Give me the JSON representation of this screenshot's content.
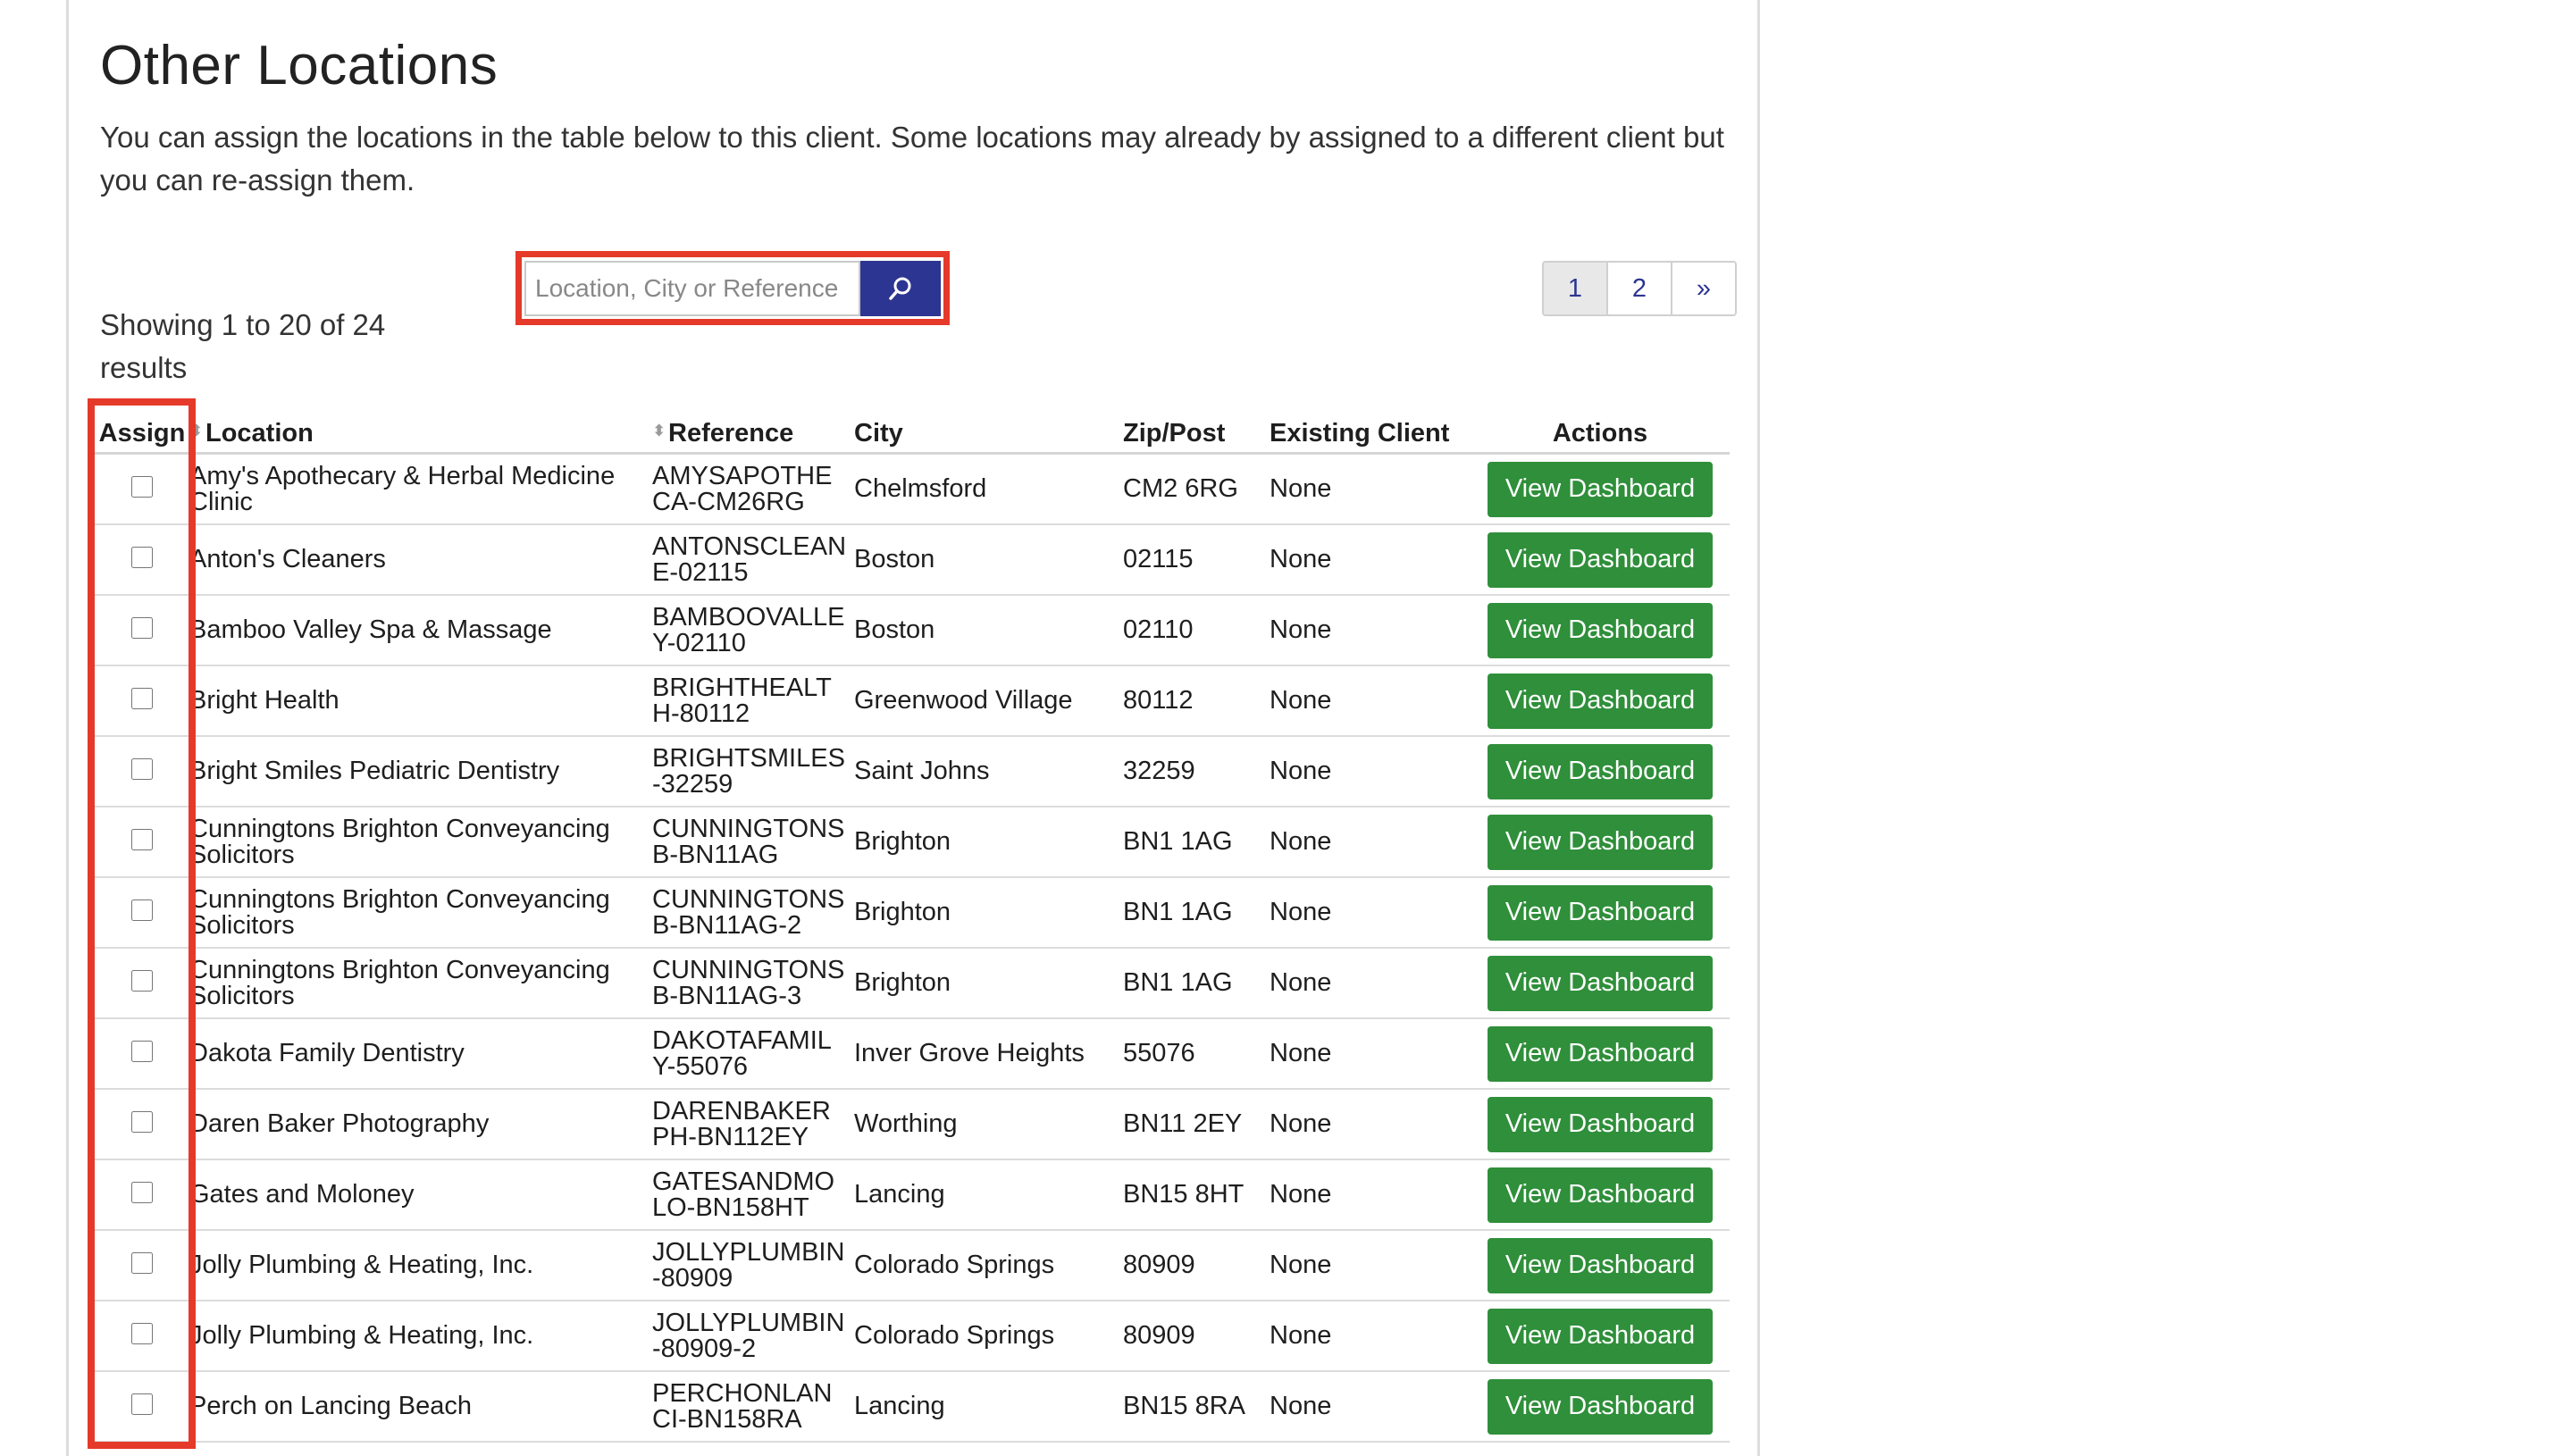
{
  "title": "Other Locations",
  "intro": "You can assign the locations in the table below to this client. Some locations may already by assigned to a different client but you can re-assign them.",
  "showing": "Showing 1 to 20 of 24 results",
  "search": {
    "placeholder": "Location, City or Reference",
    "value": "",
    "icon": "search-icon"
  },
  "pagination": {
    "pages": [
      "1",
      "2"
    ],
    "active": "1",
    "next": "»"
  },
  "table": {
    "headers": {
      "assign": "Assign",
      "location": "Location",
      "reference": "Reference",
      "city": "City",
      "zip": "Zip/Post",
      "client": "Existing Client",
      "actions": "Actions"
    },
    "action_label": "View Dashboard",
    "rows": [
      {
        "location": "Amy's Apothecary & Herbal Medicine Clinic",
        "reference": "AMYSAPOTHECA-CM26RG",
        "city": "Chelmsford",
        "zip": "CM2 6RG",
        "client": "None"
      },
      {
        "location": "Anton's Cleaners",
        "reference": "ANTONSCLEANE-02115",
        "city": "Boston",
        "zip": "02115",
        "client": "None"
      },
      {
        "location": "Bamboo Valley Spa & Massage",
        "reference": "BAMBOOVALLEY-02110",
        "city": "Boston",
        "zip": "02110",
        "client": "None"
      },
      {
        "location": "Bright Health",
        "reference": "BRIGHTHEALTH-80112",
        "city": "Greenwood Village",
        "zip": "80112",
        "client": "None"
      },
      {
        "location": "Bright Smiles Pediatric Dentistry",
        "reference": "BRIGHTSMILES-32259",
        "city": "Saint Johns",
        "zip": "32259",
        "client": "None"
      },
      {
        "location": "Cunningtons Brighton Conveyancing Solicitors",
        "reference": "CUNNINGTONSB-BN11AG",
        "city": "Brighton",
        "zip": "BN1 1AG",
        "client": "None"
      },
      {
        "location": "Cunningtons Brighton Conveyancing Solicitors",
        "reference": "CUNNINGTONSB-BN11AG-2",
        "city": "Brighton",
        "zip": "BN1 1AG",
        "client": "None"
      },
      {
        "location": "Cunningtons Brighton Conveyancing Solicitors",
        "reference": "CUNNINGTONSB-BN11AG-3",
        "city": "Brighton",
        "zip": "BN1 1AG",
        "client": "None"
      },
      {
        "location": "Dakota Family Dentistry",
        "reference": "DAKOTAFAMILY-55076",
        "city": "Inver Grove Heights",
        "zip": "55076",
        "client": "None"
      },
      {
        "location": "Daren Baker Photography",
        "reference": "DARENBAKERPH-BN112EY",
        "city": "Worthing",
        "zip": "BN11 2EY",
        "client": "None"
      },
      {
        "location": "Gates and Moloney",
        "reference": "GATESANDMOLO-BN158HT",
        "city": "Lancing",
        "zip": "BN15 8HT",
        "client": "None"
      },
      {
        "location": "Jolly Plumbing & Heating, Inc.",
        "reference": "JOLLYPLUMBIN-80909",
        "city": "Colorado Springs",
        "zip": "80909",
        "client": "None"
      },
      {
        "location": "Jolly Plumbing & Heating, Inc.",
        "reference": "JOLLYPLUMBIN-80909-2",
        "city": "Colorado Springs",
        "zip": "80909",
        "client": "None"
      },
      {
        "location": "Perch on Lancing Beach",
        "reference": "PERCHONLANCI-BN158RA",
        "city": "Lancing",
        "zip": "BN15 8RA",
        "client": "None"
      }
    ]
  },
  "colors": {
    "primary": "#2c3591",
    "success": "#2f8f3a",
    "highlight": "#e53a2a"
  }
}
